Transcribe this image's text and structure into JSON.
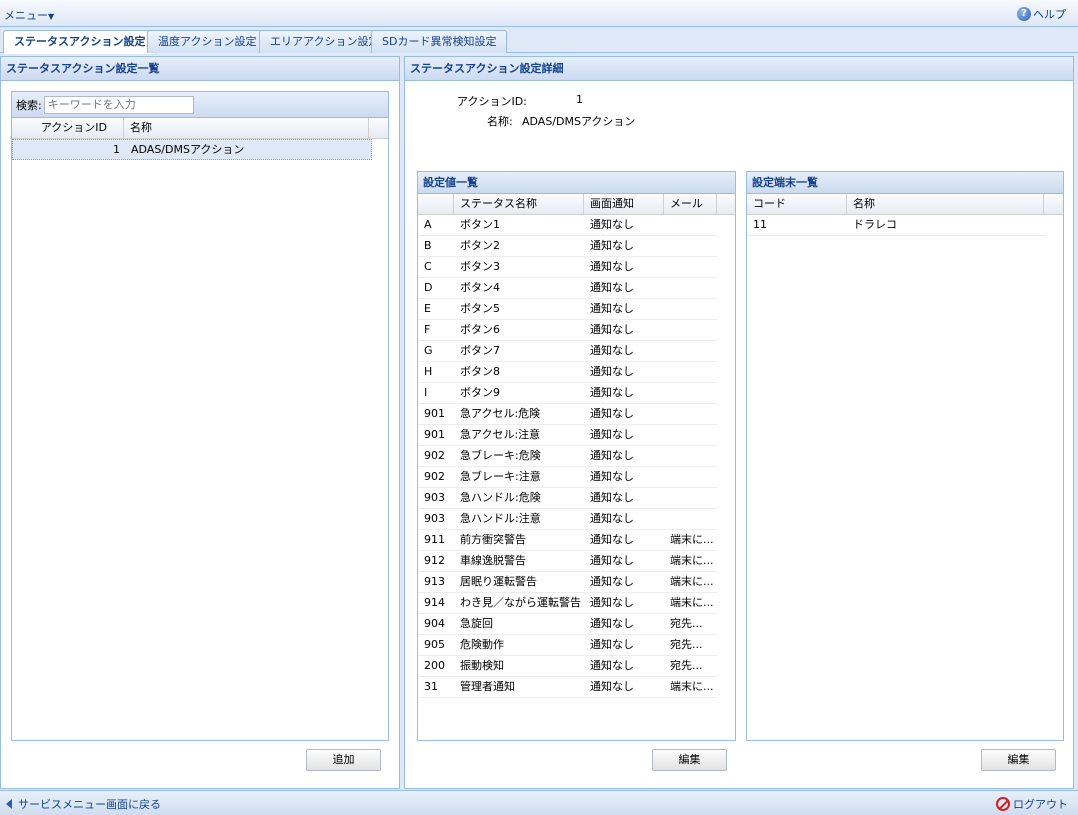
{
  "topbar": {
    "menu_label": "メニュー",
    "help_label": "ヘルプ"
  },
  "tabs": [
    {
      "label": "ステータスアクション設定"
    },
    {
      "label": "温度アクション設定"
    },
    {
      "label": "エリアアクション設定"
    },
    {
      "label": "SDカード異常検知設定"
    }
  ],
  "left_panel": {
    "title": "ステータスアクション設定一覧",
    "search_label": "検索:",
    "search_placeholder": "キーワードを入力",
    "columns": [
      "アクションID",
      "名称"
    ],
    "rows": [
      {
        "id": "1",
        "name": "ADAS/DMSアクション"
      }
    ],
    "add_button": "追加"
  },
  "right_panel": {
    "title": "ステータスアクション設定詳細",
    "action_id_label": "アクションID:",
    "action_id_value": "1",
    "name_label": "名称:",
    "name_value": "ADAS/DMSアクション",
    "values_grid": {
      "title": "設定値一覧",
      "columns": [
        "",
        "ステータス名称",
        "画面通知",
        "メール"
      ],
      "rows": [
        {
          "code": "A",
          "name": "ボタン1",
          "notify": "通知なし",
          "mail": ""
        },
        {
          "code": "B",
          "name": "ボタン2",
          "notify": "通知なし",
          "mail": ""
        },
        {
          "code": "C",
          "name": "ボタン3",
          "notify": "通知なし",
          "mail": ""
        },
        {
          "code": "D",
          "name": "ボタン4",
          "notify": "通知なし",
          "mail": ""
        },
        {
          "code": "E",
          "name": "ボタン5",
          "notify": "通知なし",
          "mail": ""
        },
        {
          "code": "F",
          "name": "ボタン6",
          "notify": "通知なし",
          "mail": ""
        },
        {
          "code": "G",
          "name": "ボタン7",
          "notify": "通知なし",
          "mail": ""
        },
        {
          "code": "H",
          "name": "ボタン8",
          "notify": "通知なし",
          "mail": ""
        },
        {
          "code": "I",
          "name": "ボタン9",
          "notify": "通知なし",
          "mail": ""
        },
        {
          "code": "901",
          "name": "急アクセル:危険",
          "notify": "通知なし",
          "mail": ""
        },
        {
          "code": "901",
          "name": "急アクセル:注意",
          "notify": "通知なし",
          "mail": ""
        },
        {
          "code": "902",
          "name": "急ブレーキ:危険",
          "notify": "通知なし",
          "mail": ""
        },
        {
          "code": "902",
          "name": "急ブレーキ:注意",
          "notify": "通知なし",
          "mail": ""
        },
        {
          "code": "903",
          "name": "急ハンドル:危険",
          "notify": "通知なし",
          "mail": ""
        },
        {
          "code": "903",
          "name": "急ハンドル:注意",
          "notify": "通知なし",
          "mail": ""
        },
        {
          "code": "911",
          "name": "前方衝突警告",
          "notify": "通知なし",
          "mail": "端末に..."
        },
        {
          "code": "912",
          "name": "車線逸脱警告",
          "notify": "通知なし",
          "mail": "端末に..."
        },
        {
          "code": "913",
          "name": "居眠り運転警告",
          "notify": "通知なし",
          "mail": "端末に..."
        },
        {
          "code": "914",
          "name": "わき見／ながら運転警告",
          "notify": "通知なし",
          "mail": "端末に..."
        },
        {
          "code": "904",
          "name": "急旋回",
          "notify": "通知なし",
          "mail": "宛先..."
        },
        {
          "code": "905",
          "name": "危険動作",
          "notify": "通知なし",
          "mail": "宛先..."
        },
        {
          "code": "200",
          "name": "振動検知",
          "notify": "通知なし",
          "mail": "宛先..."
        },
        {
          "code": "31",
          "name": "管理者通知",
          "notify": "通知なし",
          "mail": "端末に..."
        }
      ],
      "edit_button": "編集"
    },
    "terminal_grid": {
      "title": "設定端末一覧",
      "columns": [
        "コード",
        "名称"
      ],
      "rows": [
        {
          "code": "11",
          "name": "ドラレコ"
        }
      ],
      "edit_button": "編集"
    }
  },
  "bottombar": {
    "back_label": "サービスメニュー画面に戻る",
    "logout_label": "ログアウト"
  }
}
